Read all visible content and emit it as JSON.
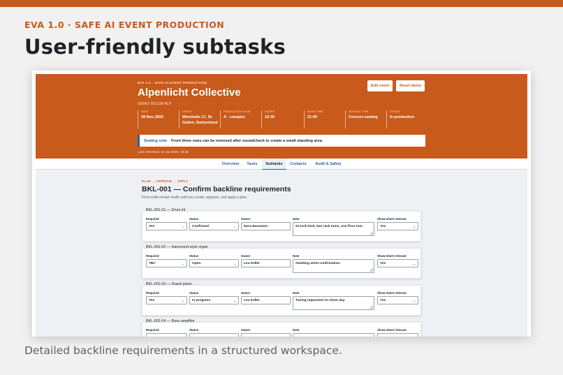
{
  "slide": {
    "eyebrow": "EVA 1.0 · SAFE AI EVENT PRODUCTION",
    "headline": "User-friendly subtasks",
    "caption": "Detailed backline requirements in a structured workspace.",
    "accent_color": "#c85a1b"
  },
  "app": {
    "eyebrow": "EVA 1.0 · SAFE AI EVENT PRODUCTION",
    "event_name": "Alpenlicht Collective",
    "event_code": "DEMO-261128-ALP",
    "buttons": {
      "edit": "Edit event",
      "reset": "Reset demo"
    },
    "facts": [
      {
        "label": "DATE",
        "value": "28 Nov 2026"
      },
      {
        "label": "VENUE",
        "value": "Werkhalle 17, St. Gallen, Switzerland"
      },
      {
        "label": "PRODUCTION LEVEL",
        "value": "A · complex"
      },
      {
        "label": "DOORS",
        "value": "19:30"
      },
      {
        "label": "SHOW TIME",
        "value": "21:00"
      },
      {
        "label": "SEATING TYPE",
        "value": "Concert seating"
      },
      {
        "label": "STATUS",
        "value": "In production"
      }
    ],
    "seating_note": {
      "label": "Seating note",
      "text": "Front three rows can be removed after soundcheck to create a small standing area."
    },
    "last_refreshed": "Last refreshed: 18 Jul 2026, 19:38",
    "tabs": [
      {
        "label": "Overview",
        "active": false
      },
      {
        "label": "Tasks",
        "active": false
      },
      {
        "label": "Subtasks",
        "active": true
      },
      {
        "label": "Contacts",
        "active": false
      },
      {
        "label": "Audit & Safety",
        "active": false
      }
    ],
    "subtasks": {
      "plan_label": "PLAN → APPROVE → APPLY",
      "title": "BKL-001 — Confirm backline requirements",
      "subtitle": "Form edits remain drafts until you create, approve, and apply a plan.",
      "field_labels": {
        "required": "Required",
        "status": "Status",
        "owner": "Owner",
        "note": "Note",
        "show_sheet": "Show-sheet relevant"
      },
      "items": [
        {
          "title": "BKL-001-01 — Drum kit",
          "required": "Yes",
          "status": "Confirmed",
          "owner": "Nora Baumann",
          "note": "22-inch kick, two rack toms, one floor tom.",
          "show_sheet": "Yes"
        },
        {
          "title": "BKL-001-02 — Hammond-style organ",
          "required": "TBC",
          "status": "Open",
          "owner": "Lea Keller",
          "note": "Awaiting artist confirmation.",
          "show_sheet": "Yes"
        },
        {
          "title": "BKL-001-03 — Grand piano",
          "required": "Yes",
          "status": "In progress",
          "owner": "Lea Keller",
          "note": "Tuning requested on show day.",
          "show_sheet": "Yes"
        },
        {
          "title": "BKL-001-04 — Bass amplifier",
          "required": "",
          "status": "",
          "owner": "",
          "note": "",
          "show_sheet": ""
        }
      ]
    }
  }
}
